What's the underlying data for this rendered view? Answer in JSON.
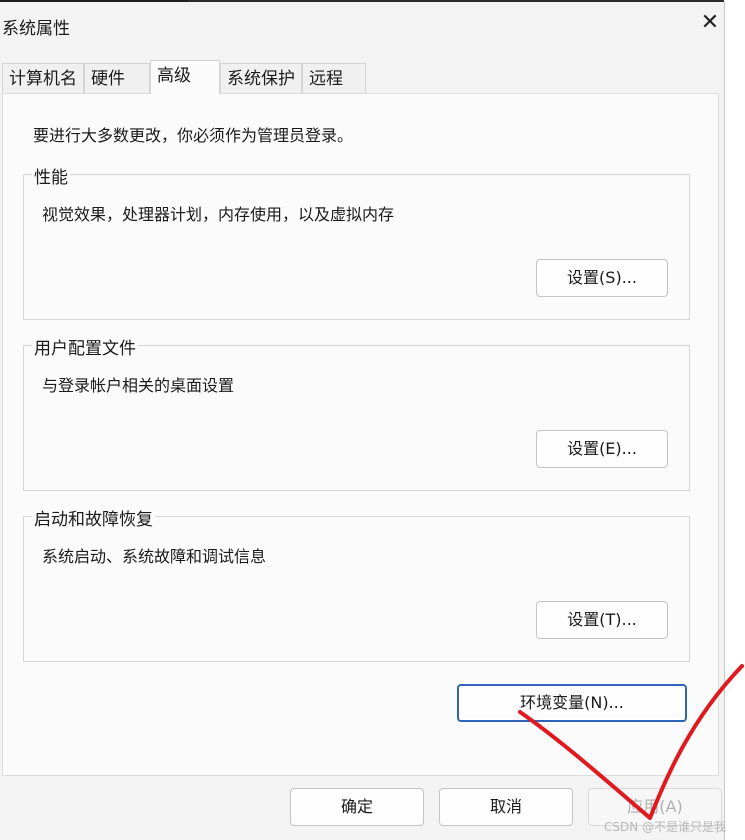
{
  "window": {
    "title": "系统属性",
    "close_glyph": "✕"
  },
  "tabs": [
    {
      "label": "计算机名",
      "active": false
    },
    {
      "label": "硬件",
      "active": false
    },
    {
      "label": "高级",
      "active": true
    },
    {
      "label": "系统保护",
      "active": false
    },
    {
      "label": "远程",
      "active": false
    }
  ],
  "advanced": {
    "admin_note": "要进行大多数更改，你必须作为管理员登录。",
    "performance": {
      "title": "性能",
      "description": "视觉效果，处理器计划，内存使用，以及虚拟内存",
      "button_label": "设置(S)..."
    },
    "user_profiles": {
      "title": "用户配置文件",
      "description": "与登录帐户相关的桌面设置",
      "button_label": "设置(E)..."
    },
    "startup_recovery": {
      "title": "启动和故障恢复",
      "description": "系统启动、系统故障和调试信息",
      "button_label": "设置(T)..."
    },
    "env_vars_button": "环境变量(N)..."
  },
  "footer": {
    "ok": "确定",
    "cancel": "取消",
    "apply": "应用(A)"
  },
  "watermark": "CSDN @不是谁只是我",
  "colors": {
    "annotation": "#e0191f",
    "focus": "#2f63b8"
  }
}
